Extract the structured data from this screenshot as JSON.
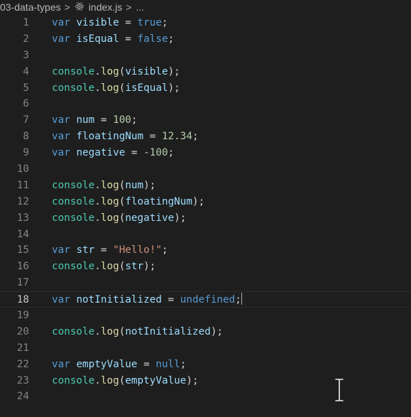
{
  "breadcrumb": {
    "folder": "03-data-types",
    "separator": ">",
    "file": "index.js",
    "ellipsis": "..."
  },
  "icons": {
    "file_icon": "react-icon",
    "mouse": "text-cursor-icon"
  },
  "colors": {
    "background": "#1e1e1e",
    "keyword": "#569cd6",
    "variable": "#9cdcfe",
    "number": "#b5cea8",
    "string": "#ce9178",
    "object": "#4ec9b0",
    "function": "#dcdcaa",
    "line_number": "#858585"
  },
  "editor": {
    "current_line": 18,
    "lines": [
      {
        "n": "1",
        "tokens": [
          [
            "keyword",
            "var"
          ],
          [
            "plain",
            " "
          ],
          [
            "var",
            "visible"
          ],
          [
            "plain",
            " = "
          ],
          [
            "bool",
            "true"
          ],
          [
            "plain",
            ";"
          ]
        ]
      },
      {
        "n": "2",
        "tokens": [
          [
            "keyword",
            "var"
          ],
          [
            "plain",
            " "
          ],
          [
            "var",
            "isEqual"
          ],
          [
            "plain",
            " = "
          ],
          [
            "bool",
            "false"
          ],
          [
            "plain",
            ";"
          ]
        ]
      },
      {
        "n": "3",
        "tokens": []
      },
      {
        "n": "4",
        "tokens": [
          [
            "object",
            "console"
          ],
          [
            "plain",
            "."
          ],
          [
            "func",
            "log"
          ],
          [
            "plain",
            "("
          ],
          [
            "var",
            "visible"
          ],
          [
            "plain",
            ");"
          ]
        ]
      },
      {
        "n": "5",
        "tokens": [
          [
            "object",
            "console"
          ],
          [
            "plain",
            "."
          ],
          [
            "func",
            "log"
          ],
          [
            "plain",
            "("
          ],
          [
            "var",
            "isEqual"
          ],
          [
            "plain",
            ");"
          ]
        ]
      },
      {
        "n": "6",
        "tokens": []
      },
      {
        "n": "7",
        "tokens": [
          [
            "keyword",
            "var"
          ],
          [
            "plain",
            " "
          ],
          [
            "var",
            "num"
          ],
          [
            "plain",
            " = "
          ],
          [
            "number",
            "100"
          ],
          [
            "plain",
            ";"
          ]
        ]
      },
      {
        "n": "8",
        "tokens": [
          [
            "keyword",
            "var"
          ],
          [
            "plain",
            " "
          ],
          [
            "var",
            "floatingNum"
          ],
          [
            "plain",
            " = "
          ],
          [
            "number",
            "12.34"
          ],
          [
            "plain",
            ";"
          ]
        ]
      },
      {
        "n": "9",
        "tokens": [
          [
            "keyword",
            "var"
          ],
          [
            "plain",
            " "
          ],
          [
            "var",
            "negative"
          ],
          [
            "plain",
            " = "
          ],
          [
            "number",
            "-100"
          ],
          [
            "plain",
            ";"
          ]
        ]
      },
      {
        "n": "10",
        "tokens": []
      },
      {
        "n": "11",
        "tokens": [
          [
            "object",
            "console"
          ],
          [
            "plain",
            "."
          ],
          [
            "func",
            "log"
          ],
          [
            "plain",
            "("
          ],
          [
            "var",
            "num"
          ],
          [
            "plain",
            ");"
          ]
        ]
      },
      {
        "n": "12",
        "tokens": [
          [
            "object",
            "console"
          ],
          [
            "plain",
            "."
          ],
          [
            "func",
            "log"
          ],
          [
            "plain",
            "("
          ],
          [
            "var",
            "floatingNum"
          ],
          [
            "plain",
            ");"
          ]
        ]
      },
      {
        "n": "13",
        "tokens": [
          [
            "object",
            "console"
          ],
          [
            "plain",
            "."
          ],
          [
            "func",
            "log"
          ],
          [
            "plain",
            "("
          ],
          [
            "var",
            "negative"
          ],
          [
            "plain",
            ");"
          ]
        ]
      },
      {
        "n": "14",
        "tokens": []
      },
      {
        "n": "15",
        "tokens": [
          [
            "keyword",
            "var"
          ],
          [
            "plain",
            " "
          ],
          [
            "var",
            "str"
          ],
          [
            "plain",
            " = "
          ],
          [
            "string",
            "\"Hello!\""
          ],
          [
            "plain",
            ";"
          ]
        ]
      },
      {
        "n": "16",
        "tokens": [
          [
            "object",
            "console"
          ],
          [
            "plain",
            "."
          ],
          [
            "func",
            "log"
          ],
          [
            "plain",
            "("
          ],
          [
            "var",
            "str"
          ],
          [
            "plain",
            ");"
          ]
        ]
      },
      {
        "n": "17",
        "tokens": []
      },
      {
        "n": "18",
        "tokens": [
          [
            "keyword",
            "var"
          ],
          [
            "plain",
            " "
          ],
          [
            "var",
            "notInitialized"
          ],
          [
            "plain",
            " = "
          ],
          [
            "keyword",
            "undefined"
          ],
          [
            "plain",
            ";"
          ]
        ]
      },
      {
        "n": "19",
        "tokens": []
      },
      {
        "n": "20",
        "tokens": [
          [
            "object",
            "console"
          ],
          [
            "plain",
            "."
          ],
          [
            "func",
            "log"
          ],
          [
            "plain",
            "("
          ],
          [
            "var",
            "notInitialized"
          ],
          [
            "plain",
            ");"
          ]
        ]
      },
      {
        "n": "21",
        "tokens": []
      },
      {
        "n": "22",
        "tokens": [
          [
            "keyword",
            "var"
          ],
          [
            "plain",
            " "
          ],
          [
            "var",
            "emptyValue"
          ],
          [
            "plain",
            " = "
          ],
          [
            "keyword",
            "null"
          ],
          [
            "plain",
            ";"
          ]
        ]
      },
      {
        "n": "23",
        "tokens": [
          [
            "object",
            "console"
          ],
          [
            "plain",
            "."
          ],
          [
            "func",
            "log"
          ],
          [
            "plain",
            "("
          ],
          [
            "var",
            "emptyValue"
          ],
          [
            "plain",
            ");"
          ]
        ]
      },
      {
        "n": "24",
        "tokens": []
      }
    ]
  }
}
